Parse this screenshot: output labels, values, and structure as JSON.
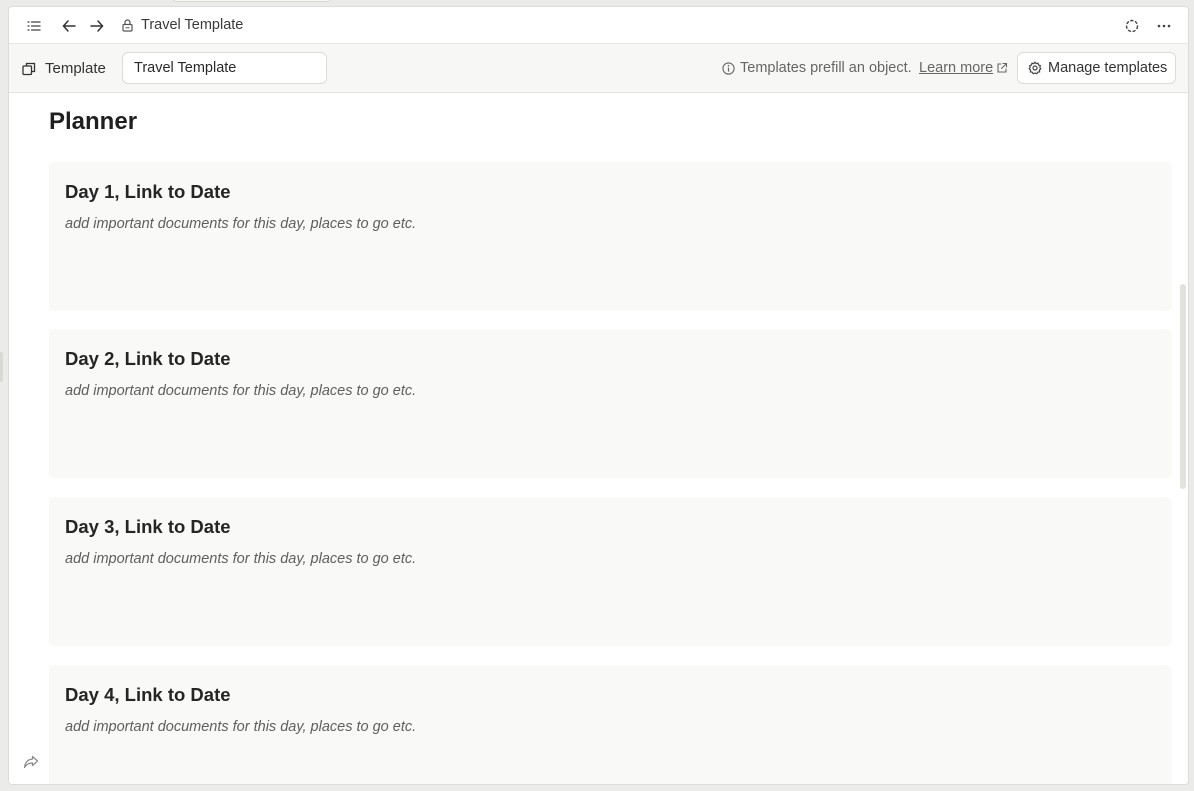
{
  "topbar": {
    "title": "Travel Template",
    "icons": {
      "sidebar": "list-icon",
      "back": "arrow-left-icon",
      "forward": "arrow-right-icon",
      "lock": "lock-icon",
      "sync": "sync-icon",
      "more": "more-icon"
    }
  },
  "template_bar": {
    "label": "Template",
    "input_value": "Travel Template",
    "info_text": "Templates prefill an object.",
    "learn_more": "Learn more",
    "manage_label": "Manage templates"
  },
  "page": {
    "heading": "Planner",
    "days": [
      {
        "title": "Day 1, Link to Date",
        "desc": "add important documents for this day, places to go etc."
      },
      {
        "title": "Day 2, Link to Date",
        "desc": "add important documents for this day, places to go etc."
      },
      {
        "title": "Day 3, Link to Date",
        "desc": "add important documents for this day, places to go etc."
      },
      {
        "title": "Day 4, Link to Date",
        "desc": "add important documents for this day, places to go etc."
      }
    ]
  },
  "colors": {
    "card_bg": "#f9f9f7",
    "bar_bg": "#f7f7f5",
    "text": "#252525"
  }
}
